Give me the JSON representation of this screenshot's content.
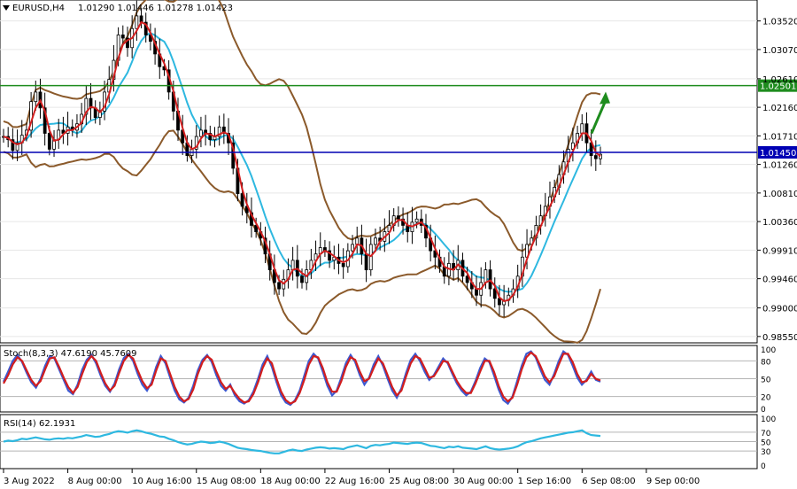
{
  "chart_data": [
    {
      "type": "candlestick",
      "title": "EURUSD,H4",
      "ohlc_text": "1.01290 1.01446 1.01278 1.01423",
      "ylim": [
        0.9845,
        1.0385
      ],
      "y_ticks": [
        "1.03520",
        "1.03070",
        "1.02610",
        "1.02160",
        "1.01710",
        "1.01260",
        "1.00810",
        "1.00360",
        "0.99910",
        "0.99460",
        "0.99000",
        "0.98550"
      ],
      "y_tick_values": [
        1.0352,
        1.0307,
        1.0261,
        1.0216,
        1.0171,
        1.0126,
        1.0081,
        1.0036,
        0.9991,
        0.9946,
        0.99,
        0.9855
      ],
      "x_ticks": [
        "3 Aug 2022",
        "8 Aug 00:00",
        "10 Aug 16:00",
        "15 Aug 08:00",
        "18 Aug 00:00",
        "22 Aug 16:00",
        "25 Aug 08:00",
        "30 Aug 00:00",
        "1 Sep 16:00",
        "6 Sep 08:00",
        "9 Sep 00:00"
      ],
      "x_tick_index": [
        0,
        14,
        28,
        42,
        56,
        70,
        84,
        98,
        112,
        126,
        140
      ],
      "price_lines": [
        {
          "value": 1.02501,
          "label": "1.02501",
          "color": "#1e8c1e"
        },
        {
          "value": 1.0145,
          "label": "1.01450",
          "color": "#0000b4"
        }
      ],
      "close_series": [
        1.017,
        1.0165,
        1.0148,
        1.016,
        1.0172,
        1.018,
        1.0225,
        1.024,
        1.0215,
        1.0175,
        1.015,
        1.0165,
        1.018,
        1.0175,
        1.0185,
        1.018,
        1.019,
        1.0205,
        1.023,
        1.0215,
        1.02,
        1.021,
        1.024,
        1.026,
        1.029,
        1.033,
        1.0325,
        1.031,
        1.034,
        1.036,
        1.035,
        1.033,
        1.032,
        1.03,
        1.028,
        1.0275,
        1.024,
        1.021,
        1.018,
        1.016,
        1.014,
        1.015,
        1.017,
        1.018,
        1.0175,
        1.0165,
        1.017,
        1.0185,
        1.0175,
        1.016,
        1.012,
        1.008,
        1.006,
        1.005,
        1.003,
        1.002,
        1.001,
        0.9985,
        0.996,
        0.994,
        0.993,
        0.9945,
        0.996,
        0.9975,
        0.995,
        0.994,
        0.996,
        0.9975,
        0.9985,
        0.9995,
        0.999,
        0.9975,
        0.998,
        0.997,
        0.9965,
        0.999,
        1.0,
        1.001,
        0.9985,
        0.996,
        1.0,
        1.001,
        1.0005,
        1.002,
        1.003,
        1.0045,
        1.004,
        1.003,
        1.002,
        1.0035,
        1.004,
        1.003,
        1.001,
        0.999,
        0.998,
        0.9965,
        0.995,
        0.997,
        0.996,
        0.9975,
        0.995,
        0.994,
        0.993,
        0.992,
        0.994,
        0.996,
        0.993,
        0.9915,
        0.9905,
        0.9912,
        0.992,
        0.993,
        0.995,
        0.998,
        1.0,
        1.001,
        1.003,
        1.0045,
        1.006,
        1.0075,
        1.009,
        1.011,
        1.013,
        1.015,
        1.016,
        1.0175,
        1.019,
        1.016,
        1.014,
        1.0135,
        1.0142
      ],
      "series": [
        {
          "name": "",
          "kind": "ma_fast",
          "color": "#d21e1e"
        },
        {
          "name": "",
          "kind": "ma_slow",
          "color": "#2eb8e0"
        },
        {
          "name": "",
          "kind": "bollinger",
          "color": "#8b5a2b"
        }
      ],
      "arrow": {
        "from_value": 1.0175,
        "to_value": 1.0235,
        "color": "#1e8c1e"
      }
    },
    {
      "type": "line",
      "title": "Stoch(8,3,3) 47.6190 45.7609",
      "ylim": [
        0,
        100
      ],
      "y_ticks": [
        "100",
        "80",
        "50",
        "20",
        "0"
      ],
      "y_tick_values": [
        100,
        80,
        50,
        20,
        0
      ],
      "levels": [
        80,
        50,
        20
      ],
      "series": [
        {
          "name": "",
          "color": "#3c5ad2",
          "values": [
            45,
            62,
            80,
            90,
            78,
            60,
            44,
            35,
            50,
            72,
            88,
            84,
            66,
            48,
            30,
            24,
            40,
            65,
            82,
            90,
            76,
            55,
            38,
            28,
            42,
            66,
            85,
            92,
            80,
            58,
            40,
            30,
            44,
            70,
            88,
            76,
            52,
            30,
            15,
            10,
            18,
            38,
            64,
            82,
            90,
            78,
            56,
            38,
            30,
            40,
            22,
            12,
            8,
            14,
            28,
            50,
            74,
            88,
            70,
            44,
            22,
            10,
            6,
            14,
            30,
            55,
            80,
            92,
            84,
            62,
            38,
            22,
            30,
            52,
            76,
            90,
            78,
            56,
            40,
            52,
            74,
            88,
            72,
            50,
            30,
            18,
            34,
            60,
            82,
            92,
            80,
            62,
            48,
            56,
            70,
            84,
            76,
            58,
            42,
            30,
            22,
            28,
            46,
            68,
            84,
            78,
            56,
            32,
            14,
            8,
            20,
            46,
            72,
            92,
            96,
            86,
            66,
            48,
            40,
            58,
            80,
            96,
            90,
            72,
            52,
            40,
            48,
            62,
            48,
            45
          ]
        },
        {
          "name": "",
          "color": "#d21e1e",
          "values": [
            42,
            56,
            74,
            86,
            80,
            64,
            48,
            38,
            46,
            66,
            84,
            86,
            70,
            52,
            36,
            26,
            36,
            58,
            78,
            88,
            80,
            60,
            42,
            30,
            38,
            60,
            80,
            90,
            84,
            64,
            46,
            34,
            40,
            64,
            84,
            80,
            58,
            36,
            20,
            12,
            16,
            32,
            58,
            78,
            88,
            82,
            62,
            44,
            33,
            38,
            26,
            16,
            10,
            12,
            24,
            44,
            68,
            84,
            76,
            50,
            28,
            14,
            8,
            12,
            26,
            48,
            74,
            88,
            86,
            68,
            44,
            28,
            28,
            46,
            70,
            86,
            82,
            62,
            46,
            50,
            68,
            84,
            76,
            56,
            36,
            22,
            30,
            54,
            76,
            88,
            84,
            68,
            52,
            54,
            66,
            80,
            78,
            62,
            46,
            34,
            26,
            26,
            42,
            62,
            80,
            80,
            62,
            38,
            20,
            12,
            18,
            40,
            66,
            86,
            94,
            88,
            72,
            54,
            44,
            54,
            74,
            92,
            92,
            78,
            58,
            44,
            46,
            58,
            50,
            47
          ]
        }
      ]
    },
    {
      "type": "line",
      "title": "RSI(14) 62.1931",
      "ylim": [
        0,
        100
      ],
      "y_ticks": [
        "100",
        "70",
        "50",
        "30",
        "0"
      ],
      "y_tick_values": [
        100,
        70,
        50,
        30,
        0
      ],
      "levels": [
        70,
        50,
        30
      ],
      "series": [
        {
          "name": "",
          "color": "#2eb8e0",
          "values": [
            50,
            52,
            51,
            53,
            56,
            55,
            57,
            59,
            57,
            55,
            54,
            56,
            57,
            56,
            58,
            57,
            59,
            61,
            64,
            62,
            60,
            61,
            64,
            66,
            70,
            72,
            71,
            69,
            72,
            74,
            72,
            69,
            67,
            64,
            61,
            60,
            56,
            53,
            49,
            46,
            44,
            45,
            48,
            50,
            49,
            47,
            48,
            50,
            48,
            45,
            41,
            37,
            35,
            34,
            32,
            31,
            30,
            28,
            26,
            25,
            25,
            28,
            31,
            33,
            31,
            30,
            33,
            35,
            37,
            38,
            37,
            35,
            36,
            35,
            34,
            38,
            40,
            42,
            39,
            36,
            41,
            43,
            42,
            44,
            45,
            48,
            47,
            46,
            45,
            47,
            48,
            47,
            44,
            41,
            40,
            38,
            36,
            39,
            38,
            40,
            37,
            36,
            35,
            34,
            37,
            40,
            36,
            34,
            33,
            34,
            35,
            37,
            40,
            45,
            49,
            51,
            54,
            57,
            59,
            61,
            63,
            65,
            67,
            69,
            70,
            72,
            74,
            68,
            64,
            63,
            62
          ]
        }
      ]
    }
  ]
}
